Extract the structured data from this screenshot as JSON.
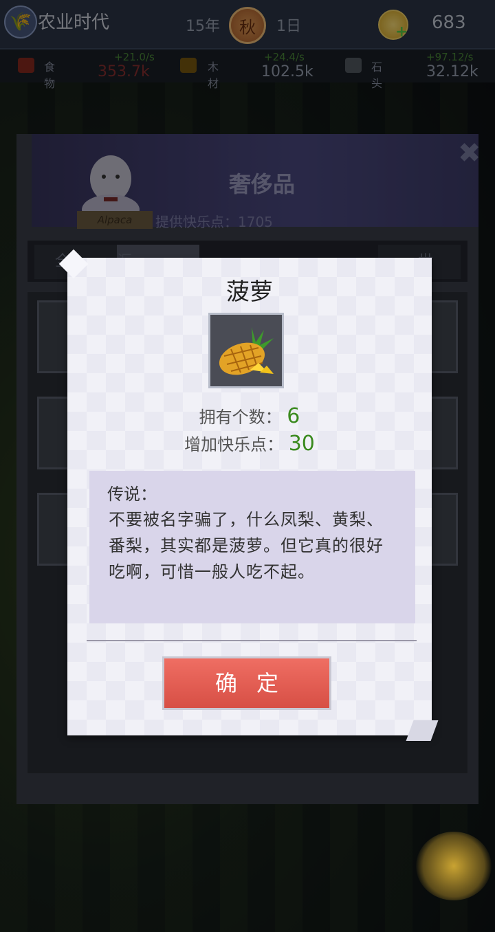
{
  "header": {
    "title": "农业时代",
    "year": "15年",
    "season": "秋",
    "day": "1日",
    "coins": "683"
  },
  "resources": [
    {
      "name": "食物",
      "rate": "+21.0/s",
      "total": "353.7k",
      "icon": "food-icon",
      "color": "#c0392b"
    },
    {
      "name": "木材",
      "rate": "+24.4/s",
      "total": "102.5k",
      "icon": "wood-icon",
      "color": "#b8860b"
    },
    {
      "name": "石头",
      "rate": "+97.12/s",
      "total": "32.12k",
      "icon": "stone-icon",
      "color": "#7f8c8d"
    }
  ],
  "panel": {
    "title": "奢侈品",
    "subtitle": "提供快乐点：1705",
    "mascot_tag": "Alpaca",
    "tabs": [
      "全",
      "汇",
      "世"
    ]
  },
  "popup": {
    "item_name": "菠萝",
    "owned_label": "拥有个数：",
    "owned_value": "6",
    "happiness_label": "增加快乐点：",
    "happiness_value": "30",
    "lore_label": "传说：",
    "lore_text": "不要被名字骗了，什么凤梨、黄梨、番梨，其实都是菠萝。但它真的很好吃啊，可惜一般人吃不起。",
    "confirm_label": "确定"
  }
}
